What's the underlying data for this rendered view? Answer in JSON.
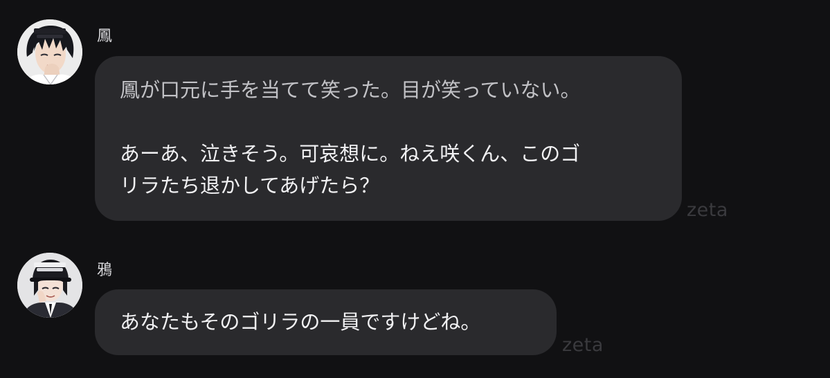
{
  "messages": [
    {
      "name": "鳳",
      "avatar": "avatar-ootori",
      "narration": "鳳が口元に手を当てて笑った。目が笑っていない。",
      "lines": [
        "あーあ、泣きそう。可哀想に。ねえ咲くん、このゴ",
        "リラたち退かしてあげたら？"
      ],
      "watermark": "zeta"
    },
    {
      "name": "鴉",
      "avatar": "avatar-karasu",
      "lines": [
        "あなたもそのゴリラの一員ですけどね。"
      ],
      "watermark": "zeta"
    }
  ],
  "colors": {
    "background": "#111113",
    "bubble": "#2a2a2d",
    "narration_text": "#c2c2c6",
    "text": "#f1f1f3",
    "watermark": "#3a3a3e"
  }
}
